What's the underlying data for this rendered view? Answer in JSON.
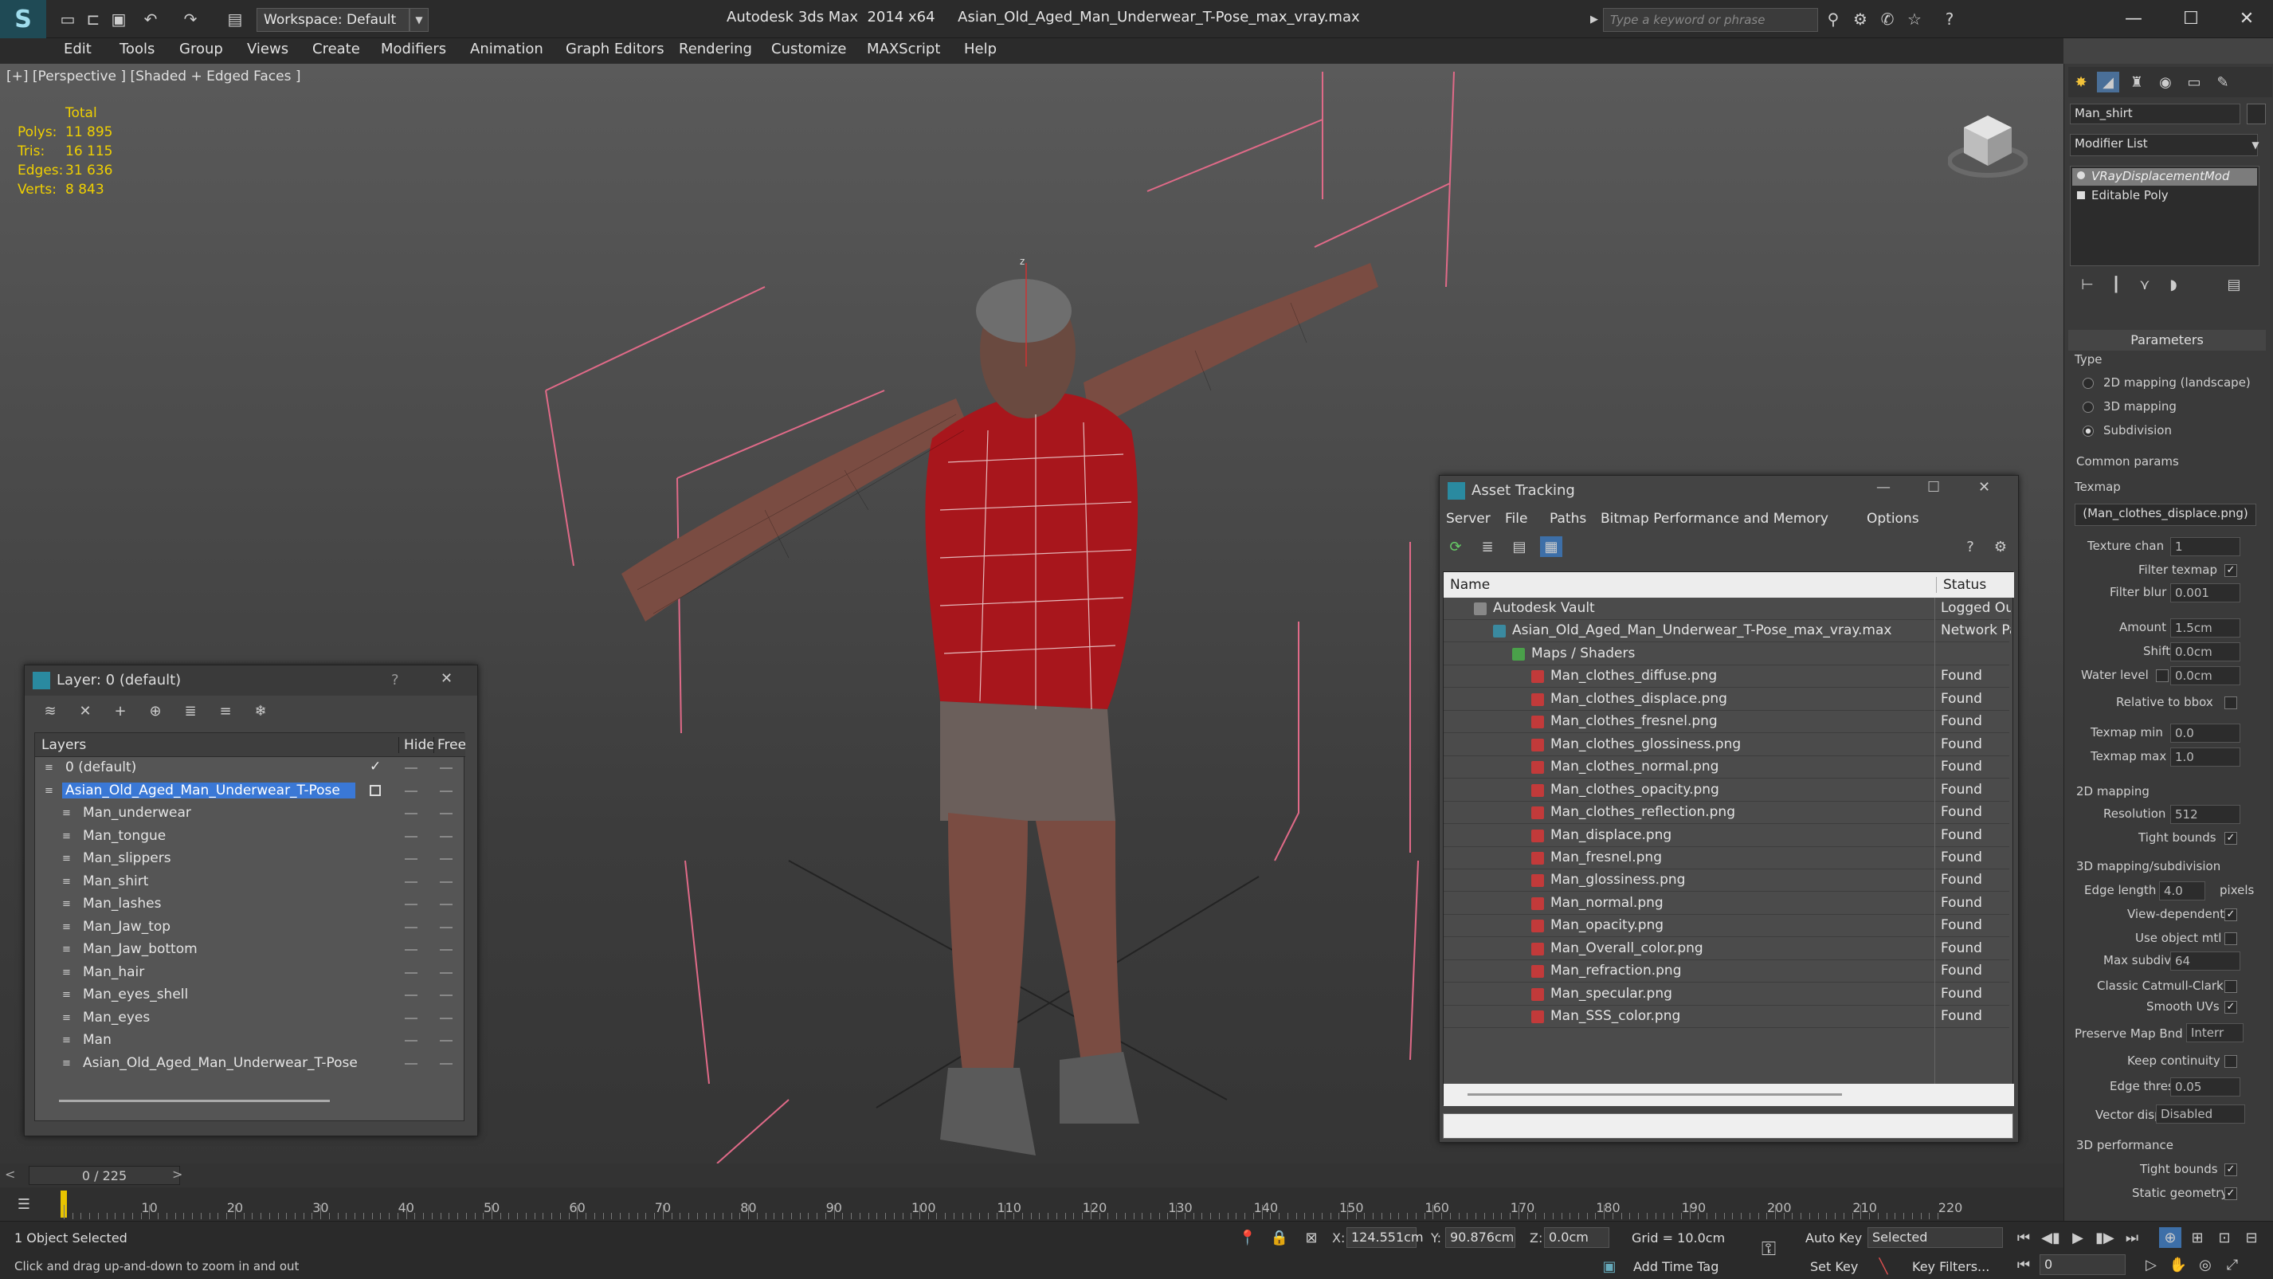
{
  "titlebar": {
    "workspace": "Workspace: Default",
    "app": "Autodesk 3ds Max  2014 x64",
    "file": "Asian_Old_Aged_Man_Underwear_T-Pose_max_vray.max",
    "search_placeholder": "Type a keyword or phrase"
  },
  "menu": [
    "Edit",
    "Tools",
    "Group",
    "Views",
    "Create",
    "Modifiers",
    "Animation",
    "Graph Editors",
    "Rendering",
    "Customize",
    "MAXScript",
    "Help"
  ],
  "viewport": {
    "label": "[+] [Perspective ] [Shaded + Edged Faces ]",
    "stats_header": "Total",
    "stats": [
      {
        "k": "Polys:",
        "v": "11 895"
      },
      {
        "k": "Tris:",
        "v": "16 115"
      },
      {
        "k": "Edges:",
        "v": "31 636"
      },
      {
        "k": "Verts:",
        "v": "8 843"
      }
    ]
  },
  "layer_dialog": {
    "title": "Layer: 0 (default)",
    "help": "?",
    "close": "✕",
    "cols": {
      "layers": "Layers",
      "hide": "Hide",
      "freeze": "Free"
    },
    "rows": [
      {
        "name": "0 (default)",
        "level": 0,
        "check": true
      },
      {
        "name": "Asian_Old_Aged_Man_Underwear_T-Pose",
        "level": 0,
        "selected": true
      },
      {
        "name": "Man_underwear",
        "level": 1
      },
      {
        "name": "Man_tongue",
        "level": 1
      },
      {
        "name": "Man_slippers",
        "level": 1
      },
      {
        "name": "Man_shirt",
        "level": 1
      },
      {
        "name": "Man_lashes",
        "level": 1
      },
      {
        "name": "Man_Jaw_top",
        "level": 1
      },
      {
        "name": "Man_Jaw_bottom",
        "level": 1
      },
      {
        "name": "Man_hair",
        "level": 1
      },
      {
        "name": "Man_eyes_shell",
        "level": 1
      },
      {
        "name": "Man_eyes",
        "level": 1
      },
      {
        "name": "Man",
        "level": 1
      },
      {
        "name": "Asian_Old_Aged_Man_Underwear_T-Pose",
        "level": 1
      }
    ]
  },
  "asset_dialog": {
    "title": "Asset Tracking",
    "menu": [
      "Server",
      "File",
      "Paths",
      "Bitmap Performance and Memory",
      "Options"
    ],
    "cols": {
      "name": "Name",
      "status": "Status"
    },
    "rows": [
      {
        "name": "Autodesk Vault",
        "status": "Logged Ou",
        "level": 0
      },
      {
        "name": "Asian_Old_Aged_Man_Underwear_T-Pose_max_vray.max",
        "status": "Network Pa",
        "level": 1
      },
      {
        "name": "Maps / Shaders",
        "status": "",
        "level": 2
      },
      {
        "name": "Man_clothes_diffuse.png",
        "status": "Found",
        "level": 3
      },
      {
        "name": "Man_clothes_displace.png",
        "status": "Found",
        "level": 3
      },
      {
        "name": "Man_clothes_fresnel.png",
        "status": "Found",
        "level": 3
      },
      {
        "name": "Man_clothes_glossiness.png",
        "status": "Found",
        "level": 3
      },
      {
        "name": "Man_clothes_normal.png",
        "status": "Found",
        "level": 3
      },
      {
        "name": "Man_clothes_opacity.png",
        "status": "Found",
        "level": 3
      },
      {
        "name": "Man_clothes_reflection.png",
        "status": "Found",
        "level": 3
      },
      {
        "name": "Man_displace.png",
        "status": "Found",
        "level": 3
      },
      {
        "name": "Man_fresnel.png",
        "status": "Found",
        "level": 3
      },
      {
        "name": "Man_glossiness.png",
        "status": "Found",
        "level": 3
      },
      {
        "name": "Man_normal.png",
        "status": "Found",
        "level": 3
      },
      {
        "name": "Man_opacity.png",
        "status": "Found",
        "level": 3
      },
      {
        "name": "Man_Overall_color.png",
        "status": "Found",
        "level": 3
      },
      {
        "name": "Man_refraction.png",
        "status": "Found",
        "level": 3
      },
      {
        "name": "Man_specular.png",
        "status": "Found",
        "level": 3
      },
      {
        "name": "Man_SSS_color.png",
        "status": "Found",
        "level": 3
      }
    ]
  },
  "command_panel": {
    "object_name": "Man_shirt",
    "modifier_list": "Modifier List",
    "stack": [
      "VRayDisplacementMod",
      "Editable Poly"
    ],
    "parameters": "Parameters",
    "type_label": "Type",
    "types": [
      "2D mapping (landscape)",
      "3D mapping",
      "Subdivision"
    ],
    "selected_type": 2,
    "common": "Common params",
    "texmap": "Texmap",
    "texmap_value": "(Man_clothes_displace.png)",
    "texture_chan": {
      "label": "Texture chan",
      "value": "1"
    },
    "filter_texmap": "Filter texmap",
    "filter_blur": {
      "label": "Filter blur",
      "value": "0.001"
    },
    "amount": {
      "label": "Amount",
      "value": "1.5cm"
    },
    "shift": {
      "label": "Shift",
      "value": "0.0cm"
    },
    "water_level": {
      "label": "Water level",
      "value": "0.0cm"
    },
    "relative_bbox": "Relative to bbox",
    "texmap_min": {
      "label": "Texmap min",
      "value": "0.0"
    },
    "texmap_max": {
      "label": "Texmap max",
      "value": "1.0"
    },
    "mapping2d": "2D mapping",
    "resolution": {
      "label": "Resolution",
      "value": "512"
    },
    "tight_bounds": "Tight bounds",
    "subdiv": "3D mapping/subdivision",
    "edge_length": {
      "label": "Edge length",
      "value": "4.0",
      "unit": "pixels"
    },
    "view_dependent": "View-dependent",
    "use_object_mtl": "Use object mtl",
    "max_subdivs": {
      "label": "Max subdivs",
      "value": "64"
    },
    "catmull": "Classic Catmull-Clark",
    "smooth_uvs": "Smooth UVs",
    "preserve_map": {
      "label": "Preserve Map Bnd",
      "value": "Interr"
    },
    "keep_continuity": "Keep continuity",
    "edge_thresh": {
      "label": "Edge thresh",
      "value": "0.05"
    },
    "vector_displ": {
      "label": "Vector displ",
      "value": "Disabled"
    },
    "perf": "3D performance",
    "tight_bounds2": "Tight bounds",
    "static_geometry": "Static geometry"
  },
  "timeline": {
    "frame": "0 / 225",
    "ticks": [
      "10",
      "20",
      "30",
      "40",
      "50",
      "60",
      "70",
      "80",
      "90",
      "100",
      "110",
      "120",
      "130",
      "140",
      "150",
      "160",
      "170",
      "180",
      "190",
      "200",
      "210",
      "220"
    ]
  },
  "status": {
    "selected": "1 Object Selected",
    "hint": "Click and drag up-and-down to zoom in and out",
    "x_label": "X:",
    "x": "124.551cm",
    "y_label": "Y:",
    "y": "90.876cm",
    "z_label": "Z:",
    "z": "0.0cm",
    "grid": "Grid = 10.0cm",
    "add_time_tag": "Add Time Tag",
    "auto_key": "Auto Key",
    "set_key": "Set Key",
    "selected_set": "Selected",
    "key_filters": "Key Filters...",
    "frame_value": "0"
  }
}
